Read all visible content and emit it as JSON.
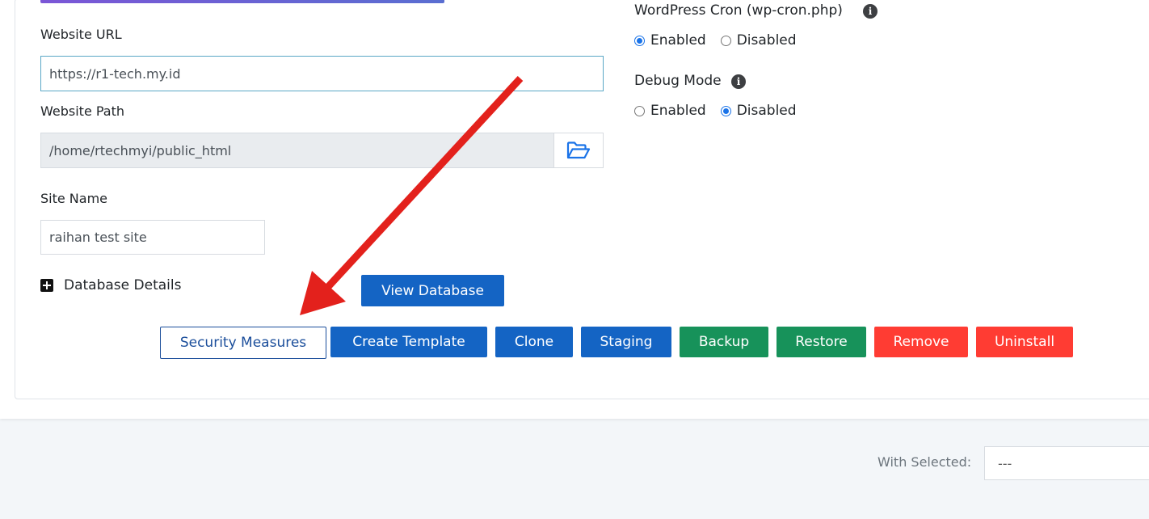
{
  "fields": {
    "website_url_label": "Website URL",
    "website_url_value": "https://r1-tech.my.id",
    "website_path_label": "Website Path",
    "website_path_value": "/home/rtechmyi/public_html",
    "site_name_label": "Site Name",
    "site_name_value": "raihan test site"
  },
  "settings": {
    "cron_label": "WordPress Cron (wp-cron.php)",
    "cron_enabled": "Enabled",
    "cron_disabled": "Disabled",
    "cron_selected": "Enabled",
    "debug_label": "Debug Mode",
    "debug_enabled": "Enabled",
    "debug_disabled": "Disabled",
    "debug_selected": "Disabled"
  },
  "database": {
    "toggle_label": "Database Details",
    "view_button": "View Database"
  },
  "actions": {
    "security": "Security Measures",
    "create_template": "Create Template",
    "clone": "Clone",
    "staging": "Staging",
    "backup": "Backup",
    "restore": "Restore",
    "remove": "Remove",
    "uninstall": "Uninstall"
  },
  "bulk": {
    "with_selected_label": "With Selected:",
    "select_value": "---"
  },
  "icons": {
    "info": "info-icon",
    "folder": "folder-open-icon",
    "plus": "plus-square-icon"
  },
  "colors": {
    "primary": "#1464c4",
    "success": "#17925a",
    "danger": "#ff3c33",
    "annotation_arrow": "#e3211c"
  }
}
